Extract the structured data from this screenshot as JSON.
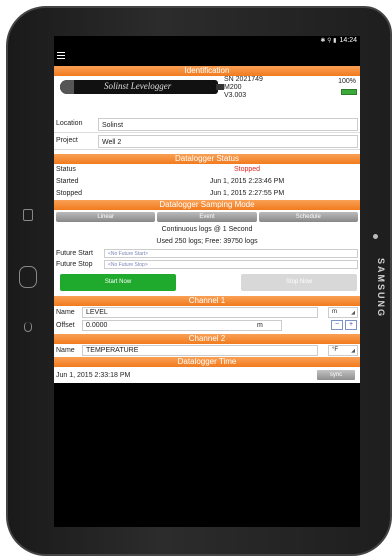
{
  "statusbar": {
    "icons": "✱ ⚲ ▮",
    "time": "14:24"
  },
  "identification": {
    "header": "Identification",
    "logger_brand": "Solinst  Levelogger",
    "serial": "SN 2021749",
    "model": "M200",
    "version": "V3.003",
    "battery_pct": "100%",
    "battery_level": 1.0,
    "location_label": "Location",
    "location_value": "Solinst",
    "project_label": "Project",
    "project_value": "Well 2"
  },
  "status": {
    "header": "Datalogger Status",
    "status_label": "Status",
    "status_value": "Stopped",
    "started_label": "Started",
    "started_value": "Jun 1, 2015 2:23:46 PM",
    "stopped_label": "Stopped",
    "stopped_value": "Jun 1, 2015 2:27:55 PM"
  },
  "sampling": {
    "header": "Datalogger Samping Mode",
    "tabs": [
      "Linear",
      "Event",
      "Schedule"
    ],
    "mode_line": "Continuous logs @  1 Second",
    "usage_line": "Used 250 logs; Free: 39750 logs",
    "future_start_label": "Future Start",
    "future_start_value": "<No Future Start>",
    "future_stop_label": "Future Stop",
    "future_stop_value": "<No Future Stop>",
    "start_button": "Start Now",
    "stop_button": "Stop Now"
  },
  "channel1": {
    "header": "Channel 1",
    "name_label": "Name",
    "name_value": "LEVEL",
    "unit": "m",
    "offset_label": "Offset",
    "offset_value": "0.0000",
    "offset_unit": "m",
    "minus": "−",
    "plus": "+"
  },
  "channel2": {
    "header": "Channel 2",
    "name_label": "Name",
    "name_value": "TEMPERATURE",
    "unit": "°F"
  },
  "time": {
    "header": "Datalogger Time",
    "value": "Jun 1, 2015 2:33:18 PM",
    "sync_button": "sync"
  },
  "device": {
    "brand": "SAMSUNG"
  }
}
